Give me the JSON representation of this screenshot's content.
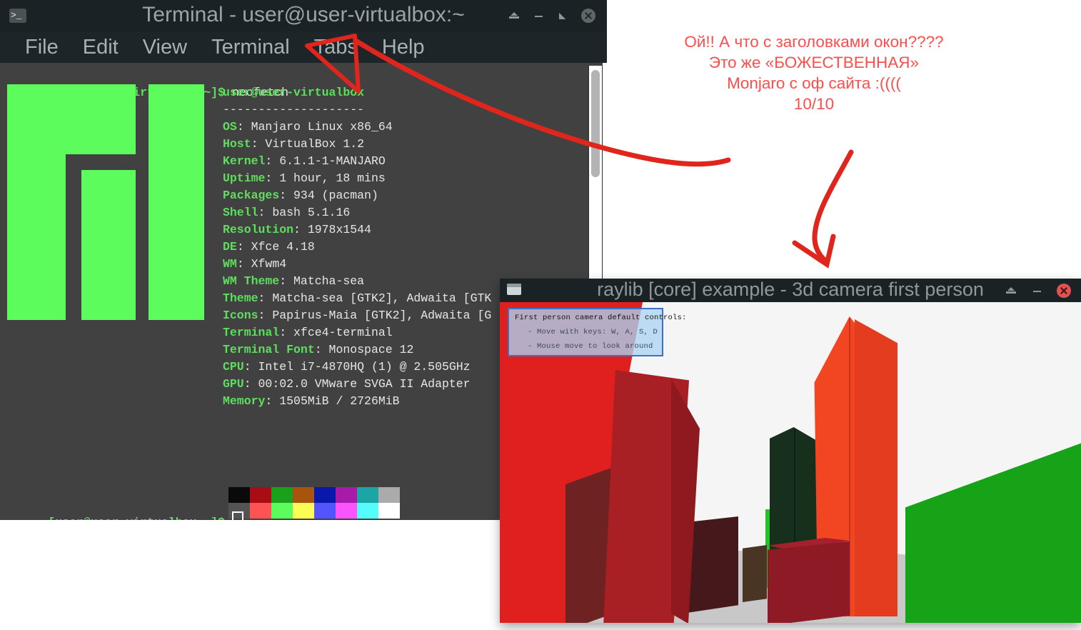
{
  "desktop": {
    "background_color": "#ffffff"
  },
  "terminal": {
    "title": "Terminal - user@user-virtualbox:~",
    "icon": "terminal-prompt-icon",
    "icon_glyph": ">_",
    "menu": [
      "File",
      "Edit",
      "View",
      "Terminal",
      "Tabs",
      "Help"
    ],
    "window_buttons": [
      "shade-button",
      "minimize-button",
      "maximize-button",
      "close-button"
    ],
    "command_prompt": "[user@user-virtualbox ~]$",
    "command": " neofetch",
    "final_prompt": "[user@user-virtualbox ~]$",
    "cursor": "block-cursor",
    "colors": {
      "titlebar": "#1b2225",
      "body": "#414141",
      "prompt_green": "#5dde5d",
      "logo_green": "#5dfc5d",
      "text": "#e6e6e6"
    },
    "neofetch": {
      "header": "user@user-virtualbox",
      "rule": "--------------------",
      "fields": [
        {
          "key": "OS",
          "value": "Manjaro Linux x86_64"
        },
        {
          "key": "Host",
          "value": "VirtualBox 1.2"
        },
        {
          "key": "Kernel",
          "value": "6.1.1-1-MANJARO"
        },
        {
          "key": "Uptime",
          "value": "1 hour, 18 mins"
        },
        {
          "key": "Packages",
          "value": "934 (pacman)"
        },
        {
          "key": "Shell",
          "value": "bash 5.1.16"
        },
        {
          "key": "Resolution",
          "value": "1978x1544"
        },
        {
          "key": "DE",
          "value": "Xfce 4.18"
        },
        {
          "key": "WM",
          "value": "Xfwm4"
        },
        {
          "key": "WM Theme",
          "value": "Matcha-sea"
        },
        {
          "key": "Theme",
          "value": "Matcha-sea [GTK2], Adwaita [GTK"
        },
        {
          "key": "Icons",
          "value": "Papirus-Maia [GTK2], Adwaita [G"
        },
        {
          "key": "Terminal",
          "value": "xfce4-terminal"
        },
        {
          "key": "Terminal Font",
          "value": "Monospace 12"
        },
        {
          "key": "CPU",
          "value": "Intel i7-4870HQ (1) @ 2.505GHz"
        },
        {
          "key": "GPU",
          "value": "00:02.0 VMware SVGA II Adapter"
        },
        {
          "key": "Memory",
          "value": "1505MiB / 2726MiB"
        }
      ],
      "palette_row1": [
        "#0a0a0a",
        "#a80d16",
        "#1ba01b",
        "#a8540f",
        "#0a17ab",
        "#a81aa8",
        "#1ba5a5",
        "#ababab"
      ],
      "palette_row2": [
        "#545454",
        "#fc5454",
        "#5dfc5d",
        "#fcfc54",
        "#5454fc",
        "#fc54fc",
        "#54fcfc",
        "#ffffff"
      ]
    }
  },
  "raylib": {
    "title": "raylib [core] example - 3d camera first person",
    "icon": "window-icon",
    "window_buttons": [
      "shade-button",
      "minimize-button",
      "close-button"
    ],
    "close_button_color": "#e05252",
    "controls": {
      "title": "First person camera default controls:",
      "items": [
        "- Move with keys: W, A, S, D",
        "- Mouse move to look around"
      ],
      "background_color": "#aad5f2",
      "border_color": "#3b73c4"
    },
    "scene": {
      "floor_color": "#c8c8c8",
      "left_wall_color": "#e01f1f",
      "right_wall_color": "#17a317",
      "obelisk_color": "#f24522",
      "sky_color": "#f5f5f5"
    }
  },
  "annotation": {
    "color": "#fd4d4d",
    "lines": [
      "Ой!! А что с заголовками окон????",
      "Это же «БОЖЕСТВЕННАЯ»",
      "Monjaro с оф сайта :((((",
      "10/10"
    ],
    "arrows": [
      "arrow-to-window-title",
      "arrow-to-raylib-window"
    ]
  }
}
